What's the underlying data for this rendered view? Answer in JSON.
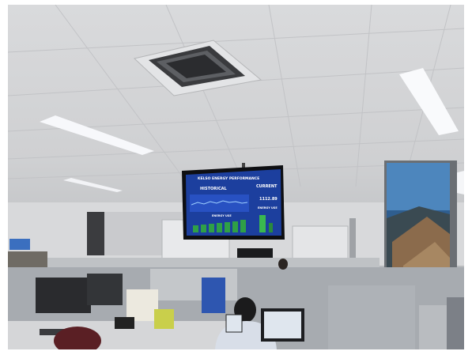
{
  "scene": {
    "description_tag": "office-photo",
    "monitor": {
      "title": "KELSO ENERGY PERFORMANCE",
      "section_left": "HISTORICAL",
      "section_right": "CURRENT",
      "current_value": "1112.89",
      "bottom_label": "ENERGY USE",
      "right_sub_label": "ENERGY USE"
    },
    "colors": {
      "ceiling": "#d6d7d9",
      "screen_blue": "#1c3f9e",
      "screen_green": "#2fa046",
      "desk_gray": "#9ea3a9"
    }
  }
}
